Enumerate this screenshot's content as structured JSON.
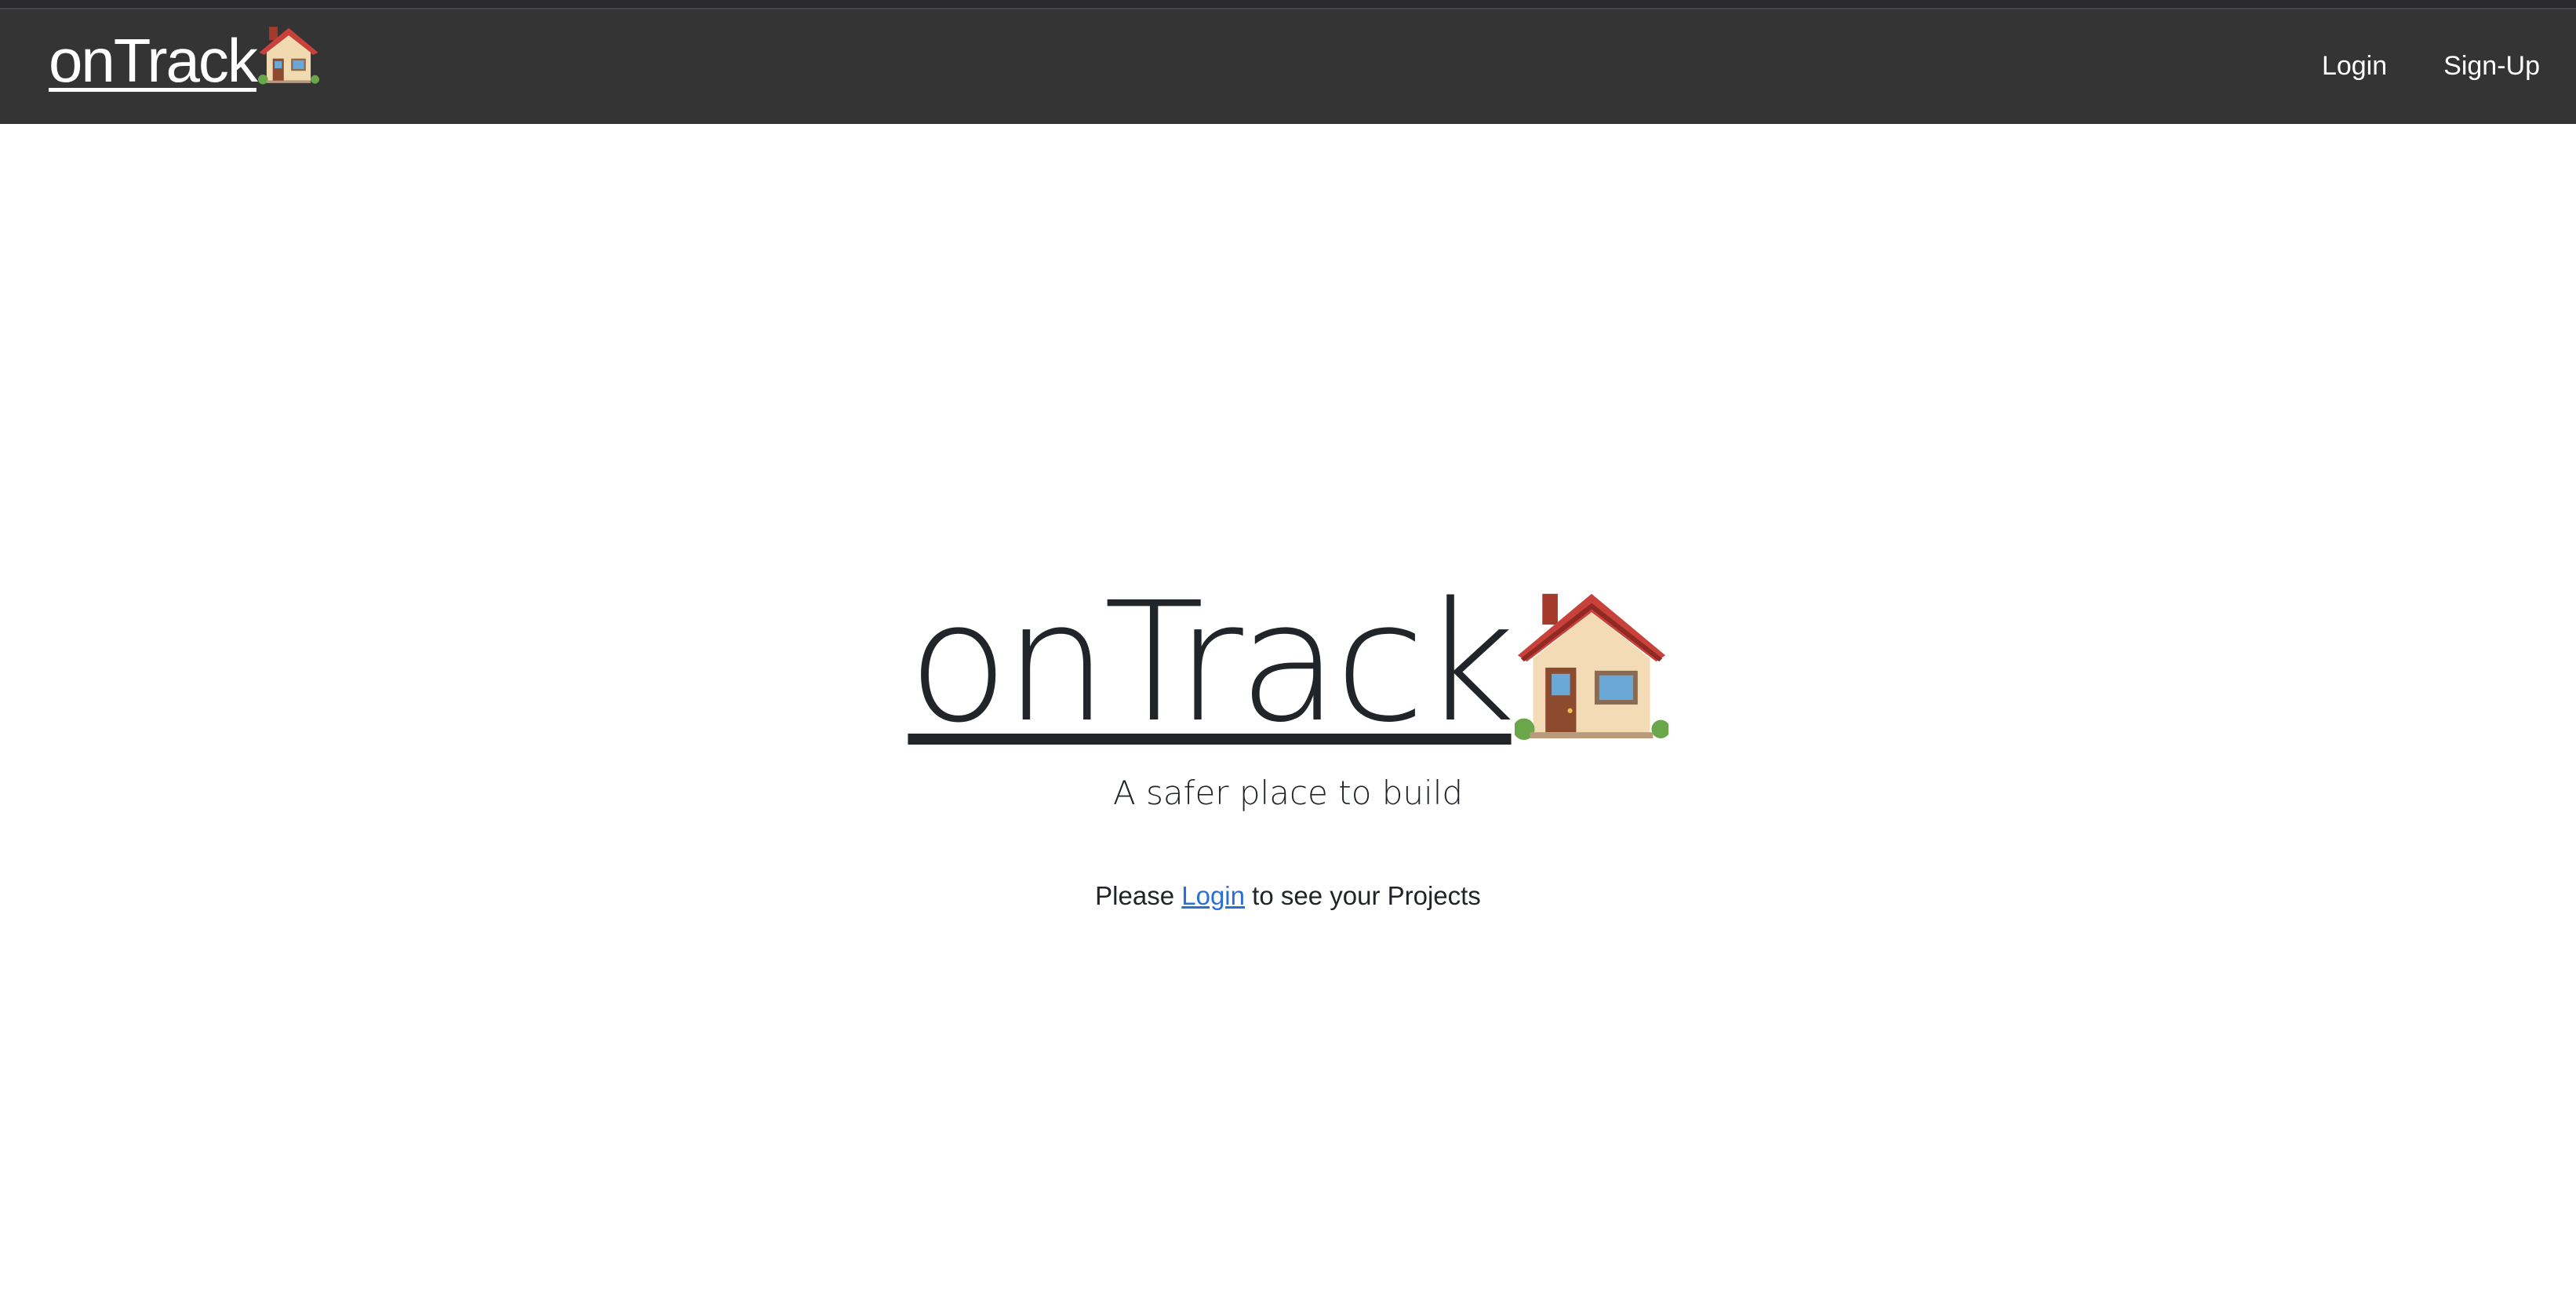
{
  "navbar": {
    "brand": "onTrack",
    "links": [
      "Login",
      "Sign-Up"
    ]
  },
  "hero": {
    "title": "onTrack",
    "subtitle": "A safer place to build"
  },
  "prompt": {
    "before": "Please",
    "link": "Login",
    "after": "to see your Projects"
  },
  "colors": {
    "navbar_bg": "#343434",
    "link": "#2a6fd6",
    "text": "#212529"
  },
  "icons": [
    "house-icon"
  ]
}
